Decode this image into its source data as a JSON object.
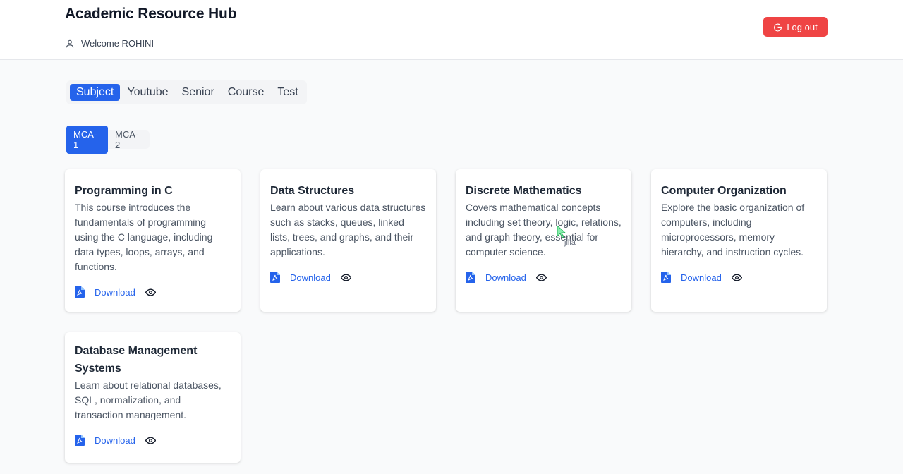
{
  "header": {
    "title": "Academic Resource Hub",
    "welcome": "Welcome ROHINI",
    "logout_label": "Log out"
  },
  "tabs": [
    {
      "label": "Subject",
      "active": true
    },
    {
      "label": "Youtube",
      "active": false
    },
    {
      "label": "Senior",
      "active": false
    },
    {
      "label": "Course",
      "active": false
    },
    {
      "label": "Test",
      "active": false
    }
  ],
  "subtabs": [
    {
      "label": "MCA-1",
      "active": true
    },
    {
      "label": "MCA-2",
      "active": false
    }
  ],
  "cards": [
    {
      "title": "Programming in C",
      "description": "This course introduces the fundamentals of programming using the C language, including data types, loops, arrays, and functions.",
      "download_label": "Download"
    },
    {
      "title": "Data Structures",
      "description": "Learn about various data structures such as stacks, queues, linked lists, trees, and graphs, and their applications.",
      "download_label": "Download"
    },
    {
      "title": "Discrete Mathematics",
      "description": "Covers mathematical concepts including set theory, logic, relations, and graph theory, essential for computer science.",
      "download_label": "Download"
    },
    {
      "title": "Computer Organization",
      "description": "Explore the basic organization of computers, including microprocessors, memory hierarchy, and instruction cycles.",
      "download_label": "Download"
    },
    {
      "title": "Database Management Systems",
      "description": "Learn about relational databases, SQL, normalization, and transaction management.",
      "download_label": "Download"
    }
  ],
  "cursor_label": "jilla",
  "icons": {
    "user": "user-icon",
    "logout": "logout-icon",
    "pdf": "pdf-file-icon",
    "view": "eye-icon"
  },
  "colors": {
    "accent": "#2563eb",
    "danger": "#ef4444",
    "background": "#f9fafb"
  }
}
